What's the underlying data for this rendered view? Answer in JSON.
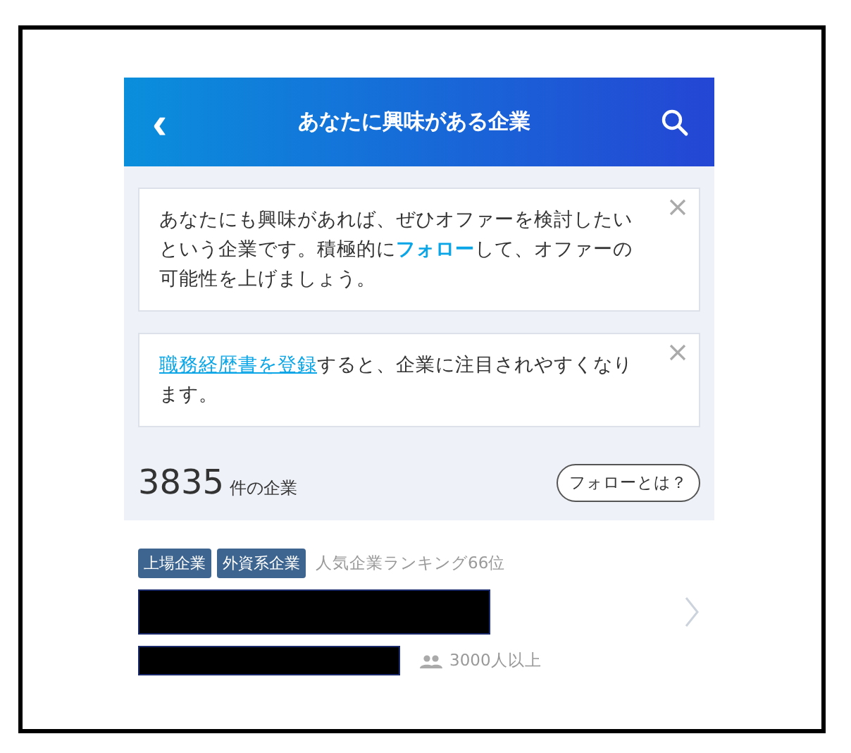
{
  "header": {
    "back": "‹",
    "title": "あなたに興味がある企業"
  },
  "notices": [
    {
      "segments": [
        {
          "kind": "plain",
          "text": "あなたにも興味があれば、ぜひオファーを検討したいという企業です。積極的に"
        },
        {
          "kind": "link",
          "text": "フォロー"
        },
        {
          "kind": "plain",
          "text": "して、オファーの可能性を上げましょう。"
        }
      ]
    },
    {
      "segments": [
        {
          "kind": "link",
          "underline": true,
          "text": "職務経歴書を登録"
        },
        {
          "kind": "plain",
          "text": "すると、企業に注目されやすくなります。"
        }
      ]
    }
  ],
  "summary": {
    "count": "3835",
    "unit": "件の企業",
    "help_button": "フォローとは？"
  },
  "companies": [
    {
      "tags": [
        "上場企業",
        "外資系企業"
      ],
      "ranking": "人気企業ランキング66位",
      "employees": "3000人以上"
    }
  ]
}
